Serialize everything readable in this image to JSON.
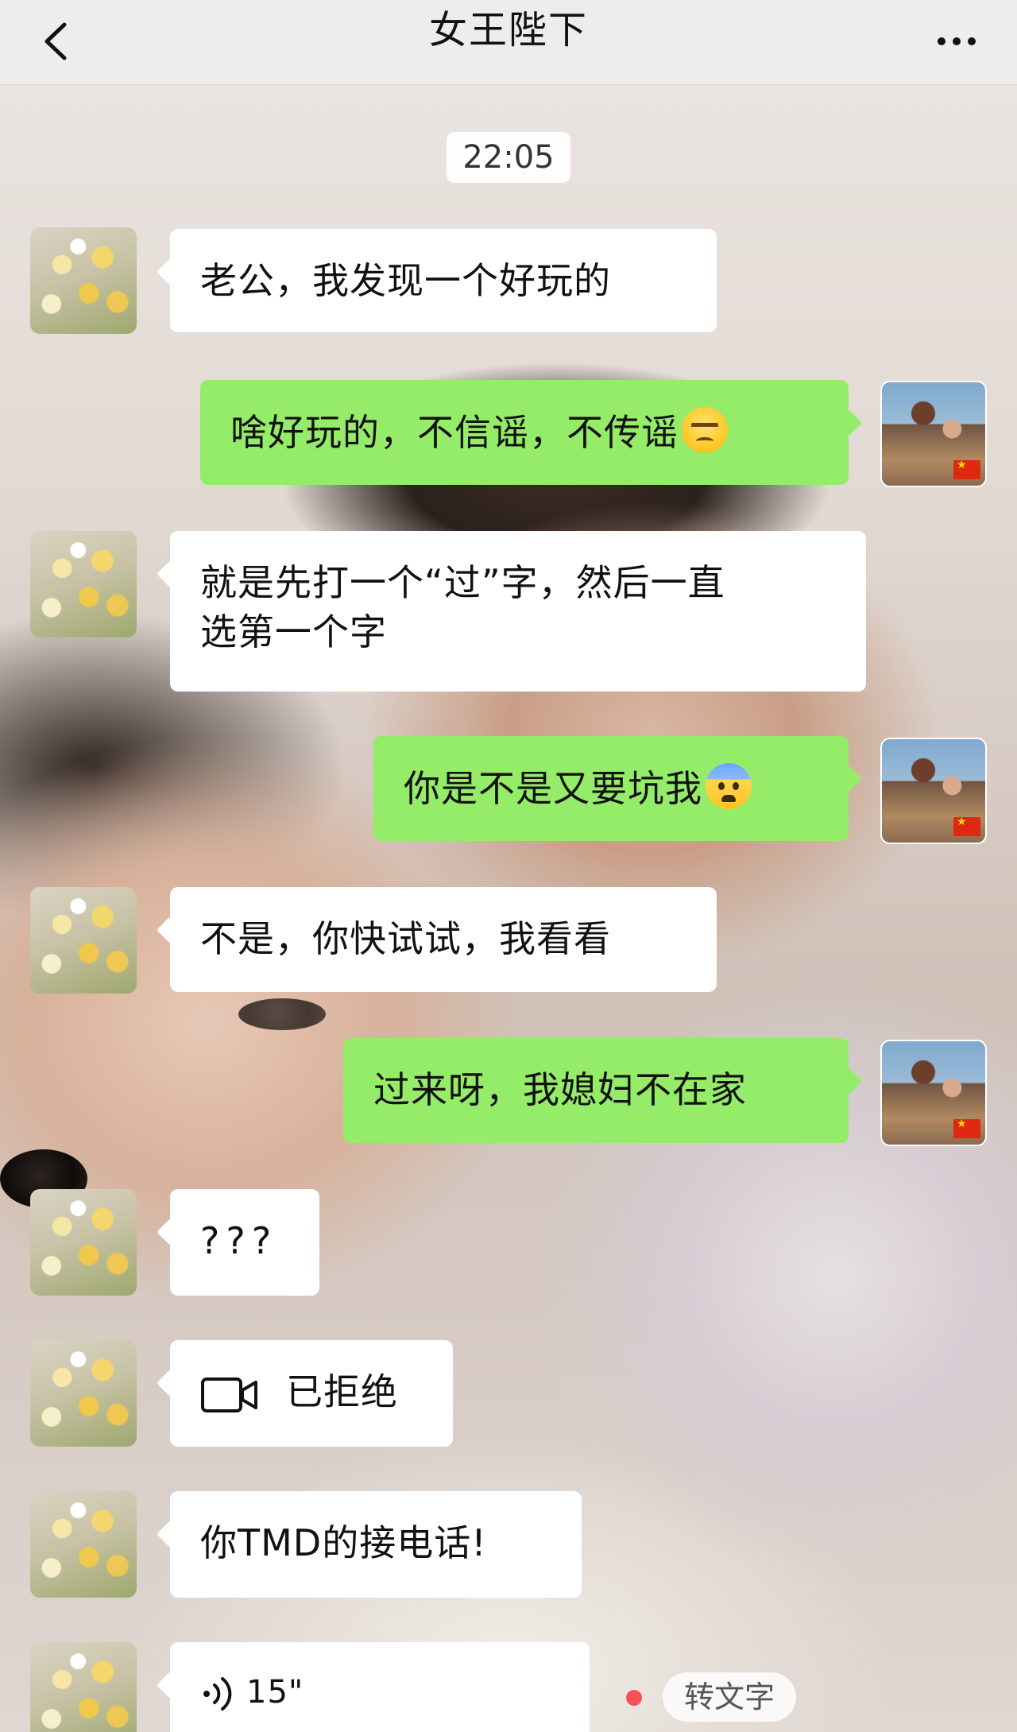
{
  "header": {
    "title": "女王陛下",
    "back_icon": "chevron-left-icon",
    "more_icon": "more-icon"
  },
  "chat": {
    "timestamp": "22:05",
    "messages": [
      {
        "side": "in",
        "text": "老公，我发现一个好玩的"
      },
      {
        "side": "out",
        "text": "啥好玩的，不信谣，不传谣",
        "emoji": "unamused-face-emoji"
      },
      {
        "side": "in",
        "line1": "就是先打一个“过”字，然后一直",
        "line2": "选第一个字"
      },
      {
        "side": "out",
        "text": "你是不是又要坑我",
        "emoji": "anxious-face-with-sweat-emoji"
      },
      {
        "side": "in",
        "text": "不是，你快试试，我看看"
      },
      {
        "side": "out",
        "text": "过来呀，我媳妇不在家"
      },
      {
        "side": "in",
        "text": "???"
      },
      {
        "side": "in",
        "type": "video-call",
        "text": "已拒绝",
        "icon": "video-camera-icon"
      },
      {
        "side": "in",
        "text": "你TMD的接电话!"
      },
      {
        "side": "in",
        "type": "voice",
        "duration": "15\"",
        "icon": "voice-wave-icon",
        "convert_label": "转文字"
      }
    ]
  },
  "colors": {
    "header_bg": "#ededed",
    "incoming_bubble": "#ffffff",
    "outgoing_bubble": "#95ec69",
    "unread_dot": "#f35353"
  }
}
